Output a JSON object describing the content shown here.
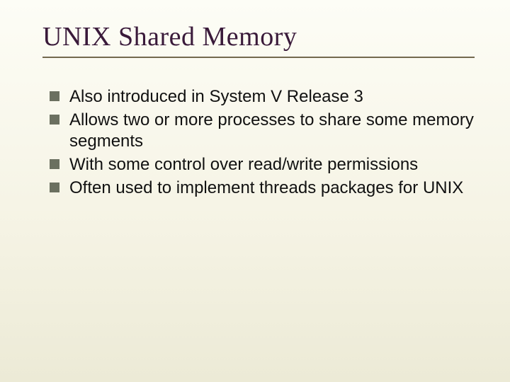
{
  "slide": {
    "title": "UNIX Shared Memory",
    "bullets": [
      "Also introduced in System V Release 3",
      "Allows two or more processes to share some memory segments",
      "With some control over read/write permissions",
      "Often used to implement threads packages for UNIX"
    ]
  }
}
